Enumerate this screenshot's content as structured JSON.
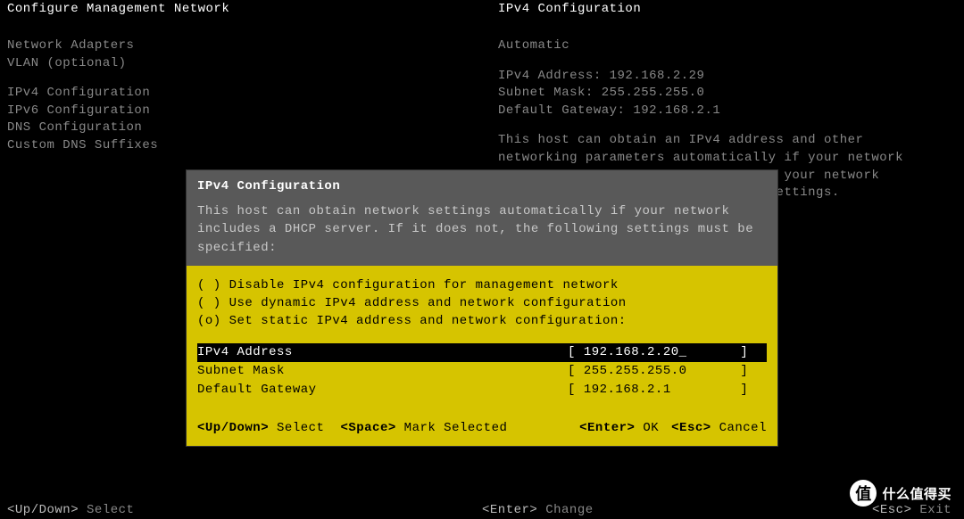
{
  "header": {
    "left_title": "Configure Management Network",
    "right_title": "IPv4 Configuration"
  },
  "sidebar": {
    "group1": [
      "Network Adapters",
      "VLAN (optional)"
    ],
    "group2": [
      "IPv4 Configuration",
      "IPv6 Configuration",
      "DNS Configuration",
      "Custom DNS Suffixes"
    ]
  },
  "info": {
    "mode": "Automatic",
    "ipv4_label": "IPv4 Address:",
    "ipv4_value": "192.168.2.29",
    "mask_label": "Subnet Mask:",
    "mask_value": "255.255.255.0",
    "gw_label": "Default Gateway:",
    "gw_value": "192.168.2.1",
    "paragraph": "This host can obtain an IPv4 address and other networking parameters automatically if your network includes a DHCP server. If not, ask your network administrator for the appropriate settings."
  },
  "dialog": {
    "title": "IPv4 Configuration",
    "description": "This host can obtain network settings automatically if your network includes a DHCP server. If it does not, the following settings must be specified:",
    "options": [
      {
        "marker": "( )",
        "label": "Disable IPv4 configuration for management network"
      },
      {
        "marker": "( )",
        "label": "Use dynamic IPv4 address and network configuration"
      },
      {
        "marker": "(o)",
        "label": "Set static IPv4 address and network configuration:"
      }
    ],
    "fields": [
      {
        "label": "IPv4 Address",
        "value": "192.168.2.20_",
        "selected": true
      },
      {
        "label": "Subnet Mask",
        "value": "255.255.255.0",
        "selected": false
      },
      {
        "label": "Default Gateway",
        "value": "192.168.2.1",
        "selected": false
      }
    ],
    "hints": {
      "updown_key": "<Up/Down>",
      "updown_label": "Select",
      "space_key": "<Space>",
      "space_label": "Mark Selected",
      "enter_key": "<Enter>",
      "enter_label": "OK",
      "esc_key": "<Esc>",
      "esc_label": "Cancel"
    }
  },
  "bottom": {
    "updown_key": "<Up/Down>",
    "updown_label": "Select",
    "enter_key": "<Enter>",
    "enter_label": "Change",
    "esc_key": "<Esc>",
    "esc_label": "Exit"
  },
  "watermark": {
    "icon_text": "值",
    "brand": "什么值得买"
  }
}
